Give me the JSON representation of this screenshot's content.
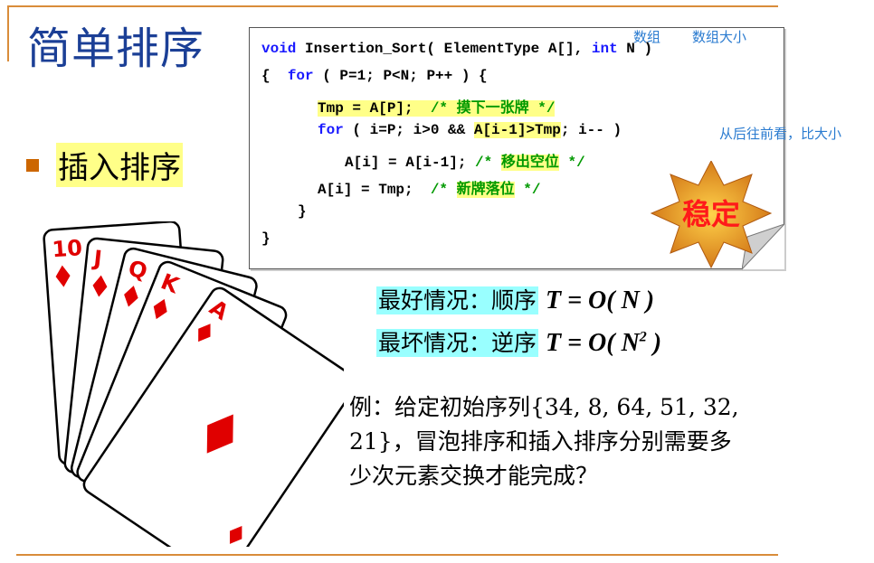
{
  "title": "简单排序",
  "bullet": "插入排序",
  "code": {
    "lines": [
      {
        "kw1": "void",
        "rest": " Insertion_Sort( ElementType A[], ",
        "kw2": "int",
        "rest2": " N )"
      },
      {
        "pre": "{  ",
        "kw": "for",
        "rest": " ( P=1; P<N; P++ ) {"
      },
      {
        "hl": "Tmp = A[P];  ",
        "cm_open": "/* ",
        "cm_text": "摸下一张牌",
        "cm_close": " */"
      },
      {
        "kw": "for",
        "rest": " ( i=P; i>0 && ",
        "hl": "A[i-1]>Tmp",
        "rest2": "; i-- )"
      },
      {
        "rest": "A[i] = A[i-1]; ",
        "cm_open": "/* ",
        "cm_text": "移出空位",
        "cm_close": " */"
      },
      {
        "rest": "A[i] = Tmp;  ",
        "cm_open": "/* ",
        "cm_text": "新牌落位",
        "cm_close": " */"
      },
      {
        "rest": "}"
      },
      {
        "rest": "}"
      }
    ]
  },
  "annotations": {
    "array": "数组",
    "array_size": "数组大小",
    "compare": "从后往前看，比大小"
  },
  "badge": "稳定",
  "complexity": {
    "best_label": "最好情况：顺序",
    "best_formula": "T = O( N )",
    "worst_label": "最坏情况：逆序",
    "worst_formula_pre": "T = O( N",
    "worst_exp": "2",
    "worst_formula_post": " )"
  },
  "example": "例：给定初始序列{34, 8, 64, 51, 32, 21}，冒泡排序和插入排序分别需要多少次元素交换才能完成？",
  "cards": [
    "10",
    "J",
    "Q",
    "K",
    "A"
  ],
  "colors": {
    "accent": "#d98c3a",
    "title": "#1b3f96",
    "highlight": "#ffff88",
    "cyan": "#99ffff",
    "keyword": "#1a1aff",
    "comment": "#009900",
    "annotation": "#2a7bd0",
    "card_red": "#e00000"
  }
}
